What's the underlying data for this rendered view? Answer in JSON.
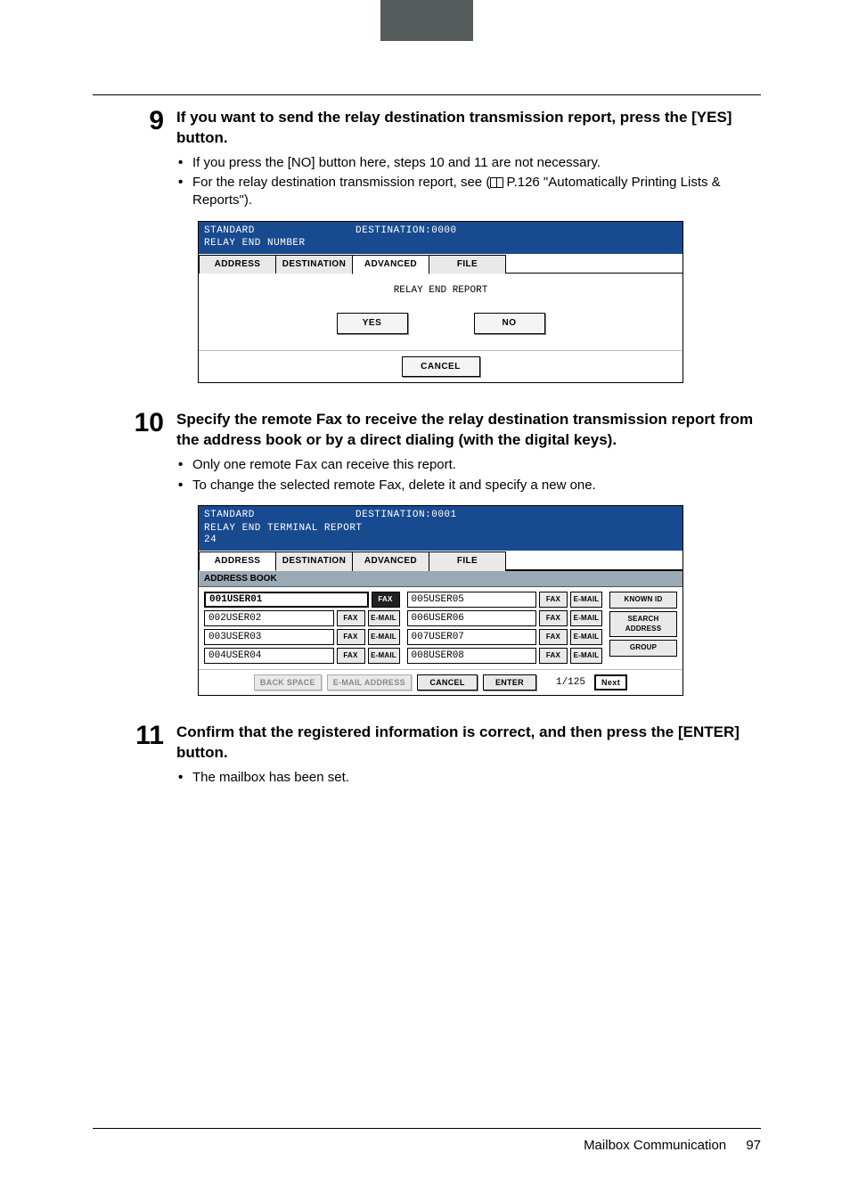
{
  "footer": {
    "section": "Mailbox Communication",
    "page": "97"
  },
  "step9": {
    "number": "9",
    "title": "If you want to send the relay destination transmission report, press the [YES] button.",
    "bullets": [
      "If you press the [NO] button here, steps 10 and 11 are not necessary.",
      "For the relay destination transmission report, see ( $BOOK P.126 \"Automatically Printing Lists & Reports\")."
    ],
    "shot": {
      "header_left": "STANDARD",
      "header_mid": "DESTINATION:0000",
      "header_sub": "RELAY END NUMBER",
      "tabs": [
        "ADDRESS",
        "DESTINATION",
        "ADVANCED",
        "FILE"
      ],
      "active_tab": 2,
      "center_label": "RELAY END REPORT",
      "yes": "YES",
      "no": "NO",
      "cancel": "CANCEL"
    }
  },
  "step10": {
    "number": "10",
    "title": "Specify the remote Fax to receive the relay destination transmission report from the address book or by a direct dialing (with the digital keys).",
    "bullets": [
      "Only one remote Fax can receive this report.",
      "To change the selected remote Fax, delete it and specify a new one."
    ],
    "shot": {
      "header_left": "STANDARD",
      "header_mid": "DESTINATION:0001",
      "header_sub": "RELAY END TERMINAL REPORT",
      "header_sub2": "24",
      "tabs": [
        "ADDRESS",
        "DESTINATION",
        "ADVANCED",
        "FILE"
      ],
      "active_tab": 0,
      "subheader": "ADDRESS BOOK",
      "left_entries": [
        {
          "name": "001USER01",
          "fax_selected": true,
          "has_email": false,
          "selected": true
        },
        {
          "name": "002USER02",
          "fax_selected": false,
          "has_email": true,
          "selected": false
        },
        {
          "name": "003USER03",
          "fax_selected": false,
          "has_email": true,
          "selected": false
        },
        {
          "name": "004USER04",
          "fax_selected": false,
          "has_email": true,
          "selected": false
        }
      ],
      "right_entries": [
        {
          "name": "005USER05"
        },
        {
          "name": "006USER06"
        },
        {
          "name": "007USER07"
        },
        {
          "name": "008USER08"
        }
      ],
      "tag_fax": "FAX",
      "tag_email": "E-MAIL",
      "side_btns": [
        "KNOWN ID",
        "SEARCH ADDRESS",
        "GROUP"
      ],
      "bottom": {
        "backspace": "BACK SPACE",
        "email_addr": "E-MAIL ADDRESS",
        "cancel": "CANCEL",
        "enter": "ENTER",
        "page": "1/125",
        "next": "Next"
      }
    }
  },
  "step11": {
    "number": "11",
    "title": "Confirm that the registered information is correct, and then press the [ENTER] button.",
    "bullets": [
      "The mailbox has been set."
    ]
  }
}
